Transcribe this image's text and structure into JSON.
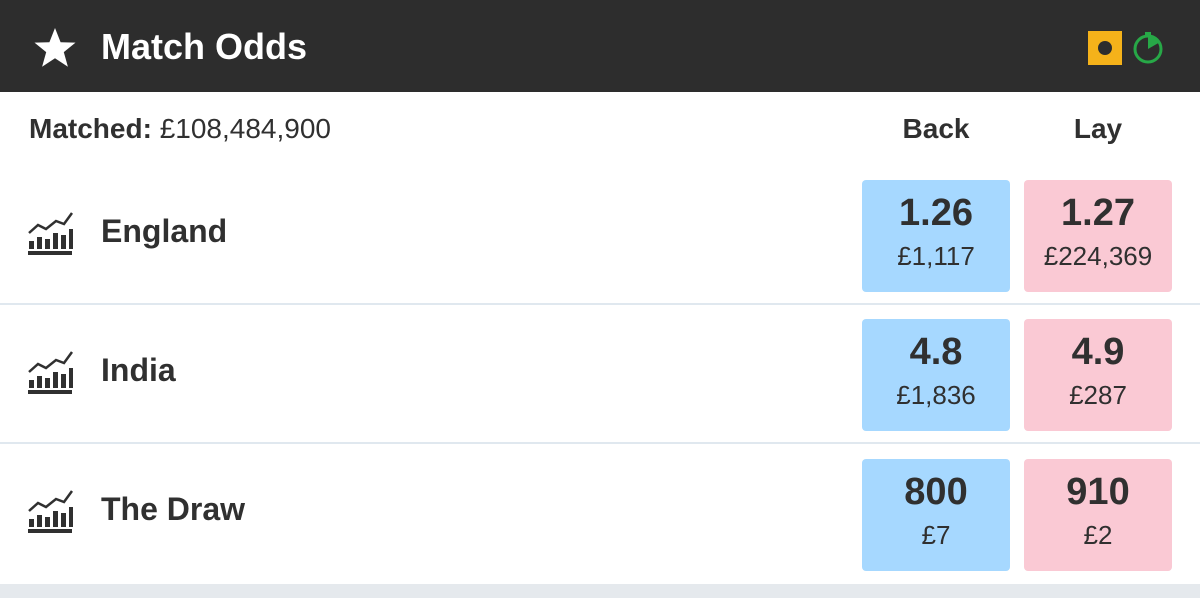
{
  "header": {
    "title": "Match Odds",
    "icons": [
      "star-icon",
      "live-indicator-icon",
      "timer-icon"
    ],
    "colors": {
      "bar": "#2d2d2d",
      "live": "#f5b21a",
      "timer": "#27a847"
    }
  },
  "summary": {
    "matched_label": "Matched:",
    "matched_value": "£108,484,900"
  },
  "columns": {
    "back": "Back",
    "lay": "Lay"
  },
  "runners": [
    {
      "name": "England",
      "back": {
        "odds": "1.26",
        "amount": "£1,117"
      },
      "lay": {
        "odds": "1.27",
        "amount": "£224,369"
      }
    },
    {
      "name": "India",
      "back": {
        "odds": "4.8",
        "amount": "£1,836"
      },
      "lay": {
        "odds": "4.9",
        "amount": "£287"
      }
    },
    {
      "name": "The Draw",
      "back": {
        "odds": "800",
        "amount": "£7"
      },
      "lay": {
        "odds": "910",
        "amount": "£2"
      }
    }
  ],
  "colors": {
    "back": "#a6d8ff",
    "lay": "#fac9d4"
  }
}
